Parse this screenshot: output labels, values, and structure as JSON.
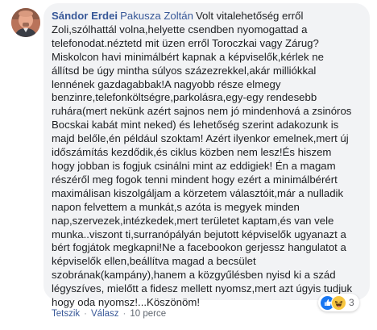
{
  "comment": {
    "author": "Sándor Erdei",
    "tagged_name": "Pakusza Zoltán",
    "text": "Volt vitalehetőség erről\nZoli,szólhattál volna,helyette csendben nyomogattad a\ntelefonodat.néztetd mit üzen erről Toroczkai vagy Zárug?\nMiskolcon havi minimálbért kapnak a képviselők,kérlek ne\nállítsd be úgy mintha súlyos százezrekkel,akár milliókkal\nlennének gazdagabbak!A nagyobb része elmegy\nbenzinre,telefonköltségre,parkolásra,egy-egy rendesebb\nruhára(mert nekünk azért sajnos nem jó mindenhová a zsinóros\nBocskai kabát mint neked) és lehetőség szerint adakozunk is\nmajd belőle,én például szoktam! Azért ilyenkor emelnek,mert új\nidőszámítás kezdődik,és ciklus közben nem lesz!És hiszem\nhogy jobban is fogjuk csinálni mint az eddigiek! Én a magam\nrészéről meg fogok tenni mindent hogy ezért a minimálbérért\nmaximálisan kiszolgáljam a körzetem választóit,már a nulladik\nnapon felvettem a munkát,s azóta is megyek minden\nnap,szervezek,intézkedek,mert területet kaptam,és van vele\nmunka..viszont ti,surranópályán bejutott képviselők ugyanazt a\nbért fogjátok megkapni!Ne a facebookon gerjessz hangulatot a\nképviselők ellen,beállítva magad a becsület\nszobrának(kampány),hanem a közgyűlésben nyisd ki a szád\nlégyszíves, mielőtt a fidesz mellett nyomsz,mert azt úgyis tudjuk\nhogy oda nyomsz!...Köszönöm!"
  },
  "reactions": {
    "icons": [
      "like-icon",
      "haha-icon"
    ],
    "count": "3",
    "colors": {
      "like": "#1877f2",
      "haha": "#f7c640"
    }
  },
  "actions": {
    "like": "Tetszik",
    "reply": "Válasz",
    "separator": "·",
    "time": "10 perce"
  },
  "colors": {
    "link": "#385898",
    "bubble": "#f2f3f5",
    "text": "#1c1e21",
    "meta": "#606770"
  }
}
